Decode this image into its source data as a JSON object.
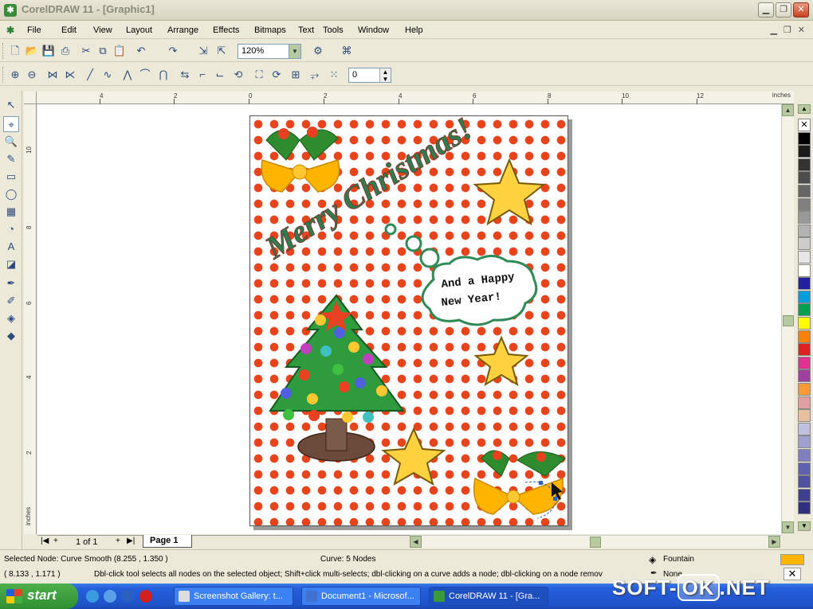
{
  "window": {
    "title": "CorelDRAW 11 - [Graphic1]",
    "app_icon": "corel-icon"
  },
  "menu": [
    "File",
    "Edit",
    "View",
    "Layout",
    "Arrange",
    "Effects",
    "Bitmaps",
    "Text",
    "Tools",
    "Window",
    "Help"
  ],
  "toolbar": {
    "zoom": "120%",
    "nudge": "0"
  },
  "rulers": {
    "horizontal_ticks": [
      "4",
      "2",
      "0",
      "2",
      "4",
      "6",
      "8",
      "10",
      "12"
    ],
    "vertical_ticks": [
      "10",
      "8",
      "6",
      "4",
      "2"
    ],
    "unit": "inches"
  },
  "artwork": {
    "headline": "Merry Christmas!",
    "bubble_line1": "And a Happy",
    "bubble_line2": "New Year!"
  },
  "page_nav": {
    "count": "1 of 1",
    "tab": "Page 1"
  },
  "palette": [
    "#FFFFFF",
    "#000000",
    "#1A1A1A",
    "#333333",
    "#4D4D4D",
    "#666666",
    "#808080",
    "#999999",
    "#B3B3B3",
    "#CCCCCC",
    "#E6E6E6",
    "#FFFFFF",
    "#2020A0",
    "#00A0E0",
    "#00A050",
    "#FFFF00",
    "#FF8000",
    "#E02020",
    "#E03090",
    "#A040A0",
    "#FF9933",
    "#E0A0A0",
    "#E8C0A0",
    "#C0C0E0",
    "#A0A0D0",
    "#8080C0",
    "#6060B0",
    "#5050A0",
    "#404090",
    "#303080"
  ],
  "status": {
    "selected": "Selected Node: Curve Smooth (8.255 , 1.350 )",
    "curve": "Curve: 5 Nodes",
    "coords": "( 8.133 , 1.171 )",
    "hint": "Dbl-click tool selects all nodes on the selected object; Shift+click multi-selects; dbl-clicking on a curve adds a node; dbl-clicking on a node remov",
    "fill_label": "Fountain",
    "outline_label": "None"
  },
  "taskbar": {
    "start": "start",
    "tasks": [
      "Screenshot Gallery: t...",
      "Document1 - Microsof...",
      "CorelDRAW 11 - [Gra..."
    ]
  },
  "watermark": {
    "prefix": "SOFT-",
    "box": "OK",
    "suffix": ".NET"
  }
}
